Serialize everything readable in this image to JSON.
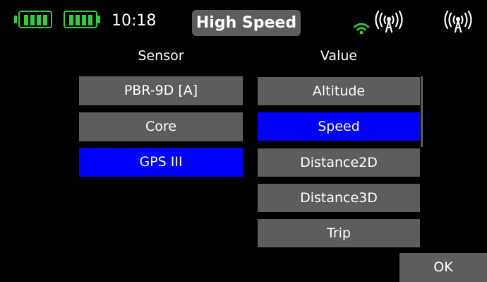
{
  "status_bar": {
    "time": "10:18",
    "title": "High Speed",
    "battery_color": "#2fd03a",
    "wifi_color": "#2fd03a",
    "icons": [
      "battery-icon",
      "battery-icon",
      "wifi-icon",
      "antenna-signal-icon",
      "antenna-signal-icon"
    ]
  },
  "headers": {
    "sensor": "Sensor",
    "value": "Value"
  },
  "sensors": [
    {
      "label": "PBR-9D [A]",
      "selected": false
    },
    {
      "label": "Core",
      "selected": false
    },
    {
      "label": "GPS III",
      "selected": true
    }
  ],
  "values": [
    {
      "label": "Altitude",
      "selected": false
    },
    {
      "label": "Speed",
      "selected": true
    },
    {
      "label": "Distance2D",
      "selected": false
    },
    {
      "label": "Distance3D",
      "selected": false
    },
    {
      "label": "Trip",
      "selected": false
    }
  ],
  "ok_label": "OK",
  "colors": {
    "background": "#000000",
    "item": "#5d5d5d",
    "selected": "#0000ff",
    "text": "#ffffff"
  }
}
